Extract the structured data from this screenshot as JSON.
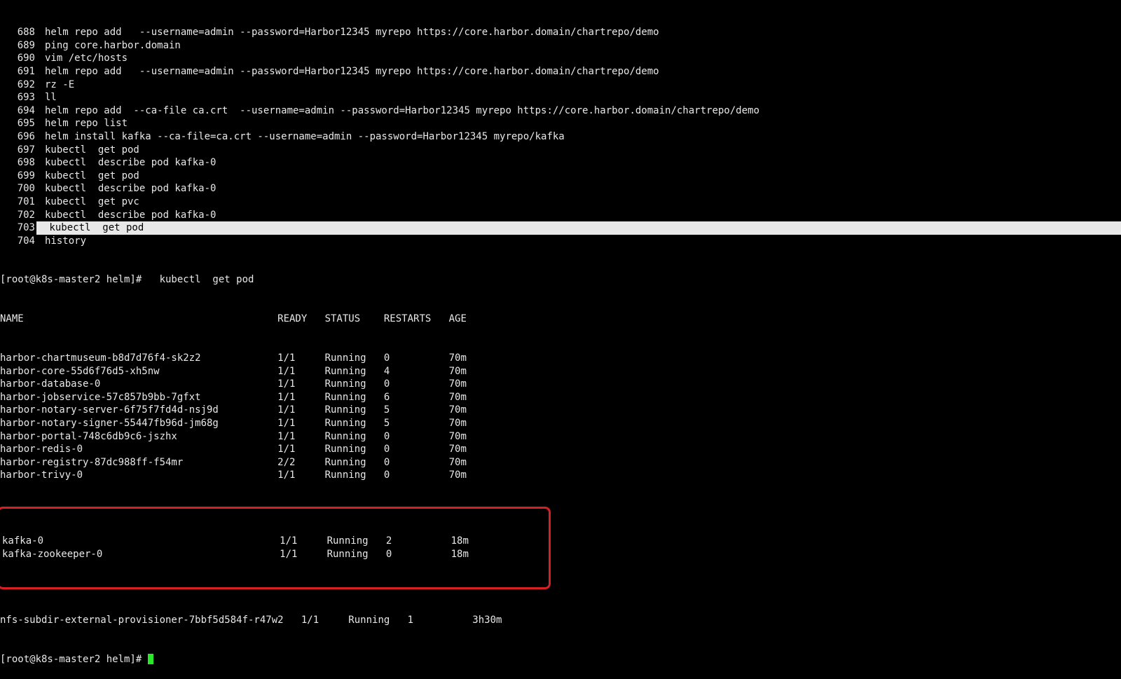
{
  "history": [
    {
      "n": "688",
      "cmd": "helm repo add   --username=admin --password=Harbor12345 myrepo https://core.harbor.domain/chartrepo/demo"
    },
    {
      "n": "689",
      "cmd": "ping core.harbor.domain"
    },
    {
      "n": "690",
      "cmd": "vim /etc/hosts"
    },
    {
      "n": "691",
      "cmd": "helm repo add   --username=admin --password=Harbor12345 myrepo https://core.harbor.domain/chartrepo/demo"
    },
    {
      "n": "692",
      "cmd": "rz -E"
    },
    {
      "n": "693",
      "cmd": "ll"
    },
    {
      "n": "694",
      "cmd": "helm repo add  --ca-file ca.crt  --username=admin --password=Harbor12345 myrepo https://core.harbor.domain/chartrepo/demo"
    },
    {
      "n": "695",
      "cmd": "helm repo list"
    },
    {
      "n": "696",
      "cmd": "helm install kafka --ca-file=ca.crt --username=admin --password=Harbor12345 myrepo/kafka"
    },
    {
      "n": "697",
      "cmd": "kubectl  get pod"
    },
    {
      "n": "698",
      "cmd": "kubectl  describe pod kafka-0"
    },
    {
      "n": "699",
      "cmd": "kubectl  get pod"
    },
    {
      "n": "700",
      "cmd": "kubectl  describe pod kafka-0"
    },
    {
      "n": "701",
      "cmd": "kubectl  get pvc"
    },
    {
      "n": "702",
      "cmd": "kubectl  describe pod kafka-0"
    },
    {
      "n": "703",
      "cmd": "kubectl  get pod",
      "selected": true
    },
    {
      "n": "704",
      "cmd": "history"
    }
  ],
  "prompt1": "[root@k8s-master2 helm]#   kubectl  get pod",
  "pods": {
    "header": "NAME                                           READY   STATUS    RESTARTS   AGE",
    "rows": [
      "harbor-chartmuseum-b8d7d76f4-sk2z2             1/1     Running   0          70m",
      "harbor-core-55d6f76d5-xh5nw                    1/1     Running   4          70m",
      "harbor-database-0                              1/1     Running   0          70m",
      "harbor-jobservice-57c857b9bb-7gfxt             1/1     Running   6          70m",
      "harbor-notary-server-6f75f7fd4d-nsj9d          1/1     Running   5          70m",
      "harbor-notary-signer-55447fb96d-jm68g          1/1     Running   5          70m",
      "harbor-portal-748c6db9c6-jszhx                 1/1     Running   0          70m",
      "harbor-redis-0                                 1/1     Running   0          70m",
      "harbor-registry-87dc988ff-f54mr                2/2     Running   0          70m",
      "harbor-trivy-0                                 1/1     Running   0          70m"
    ],
    "highlighted": [
      "kafka-0                                        1/1     Running   2          18m",
      "kafka-zookeeper-0                              1/1     Running   0          18m"
    ],
    "tail": [
      "nfs-subdir-external-provisioner-7bbf5d584f-r47w2   1/1     Running   1          3h30m"
    ]
  },
  "prompt2": "[root@k8s-master2 helm]# "
}
